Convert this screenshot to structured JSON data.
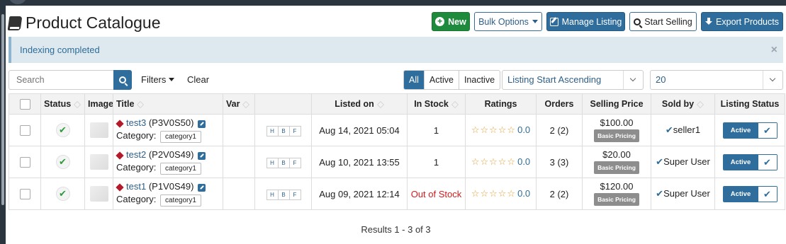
{
  "header": {
    "title": "Product Catalogue",
    "buttons": {
      "new": "New",
      "bulk": "Bulk Options",
      "manage": "Manage Listing",
      "start": "Start Selling",
      "export": "Export Products"
    }
  },
  "alert": {
    "message": "Indexing completed",
    "close": "×"
  },
  "toolbar": {
    "search_placeholder": "Search",
    "filters": "Filters",
    "clear": "Clear",
    "segments": [
      "All",
      "Active",
      "Inactive"
    ],
    "active_segment": "All",
    "sort": "Listing Start Ascending",
    "per_page": "20"
  },
  "table": {
    "headers": {
      "status": "Status",
      "image": "Image",
      "title": "Title",
      "var": "Var",
      "listed": "Listed on",
      "stock": "In Stock",
      "ratings": "Ratings",
      "orders": "Orders",
      "price": "Selling Price",
      "soldby": "Sold by",
      "lstatus": "Listing Status"
    },
    "rows": [
      {
        "title": "test3",
        "sku": "(P3V0S50)",
        "category_label": "Category:",
        "category": "category1",
        "hbf": [
          "H",
          "B",
          "F"
        ],
        "listed": "Aug 14, 2021 05:04",
        "stock": "1",
        "stars": "☆☆☆☆☆",
        "rating": "0.0",
        "orders": "2 (2)",
        "price": "$100.00",
        "pricing": "Basic Pricing",
        "soldby": "seller1",
        "listing_status": "Active"
      },
      {
        "title": "test2",
        "sku": "(P2V0S49)",
        "category_label": "Category:",
        "category": "category1",
        "hbf": [
          "H",
          "B",
          "F"
        ],
        "listed": "Aug 10, 2021 13:55",
        "stock": "1",
        "stars": "☆☆☆☆☆",
        "rating": "0.0",
        "orders": "3 (3)",
        "price": "$20.00",
        "pricing": "Basic Pricing",
        "soldby": "Super User",
        "listing_status": "Active"
      },
      {
        "title": "test1",
        "sku": "(P1V0S49)",
        "category_label": "Category:",
        "category": "category1",
        "hbf": [
          "H",
          "B",
          "F"
        ],
        "listed": "Aug 09, 2021 12:14",
        "stock": "Out of Stock",
        "stars": "☆☆☆☆☆",
        "rating": "0.0",
        "orders": "2 (2)",
        "price": "$120.00",
        "pricing": "Basic Pricing",
        "soldby": "Super User",
        "listing_status": "Active"
      }
    ]
  },
  "footer": {
    "results": "Results 1 - 3 of 3"
  },
  "colors": {
    "accent": "#2f6d9c",
    "success": "#1e8a3c",
    "danger": "#d21c1c",
    "star": "#e2a23a"
  }
}
